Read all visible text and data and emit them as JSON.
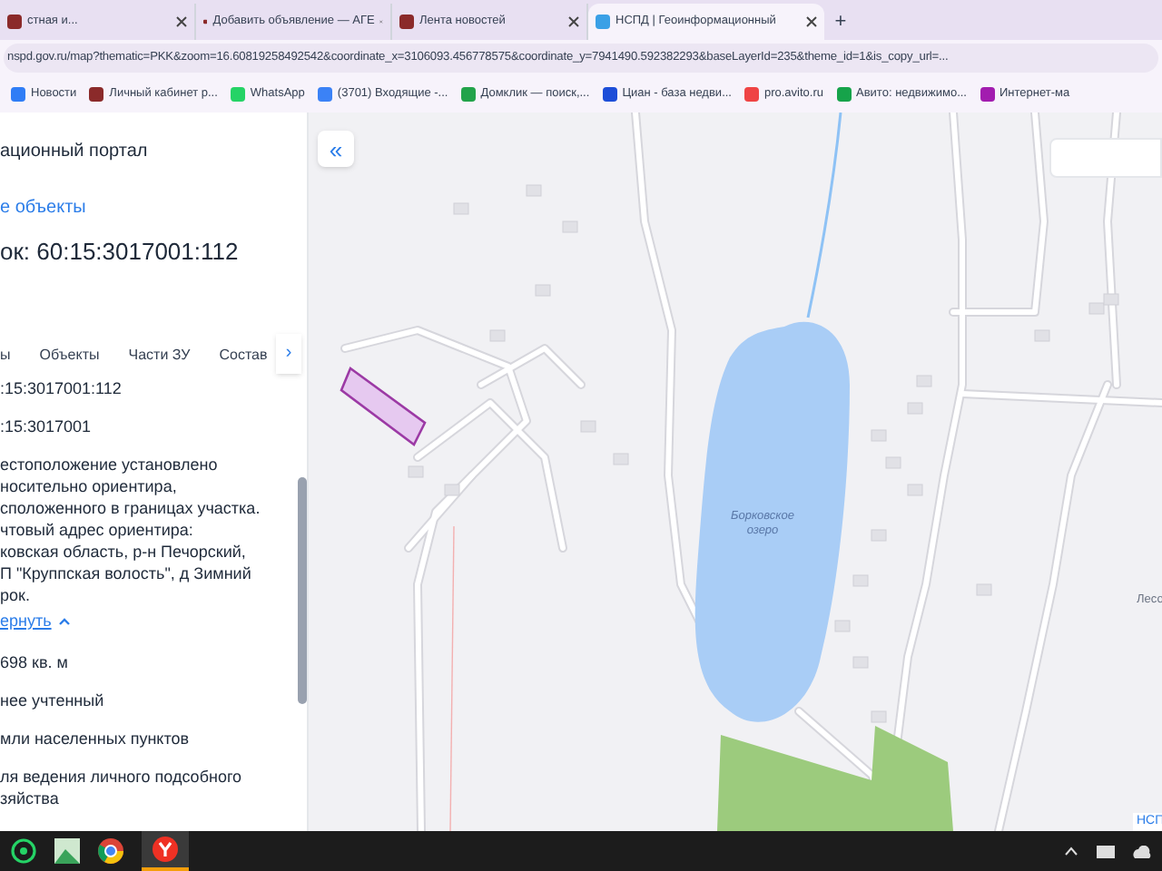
{
  "browser": {
    "tabs": [
      {
        "title": "стная и...",
        "selected": false
      },
      {
        "title": "Добавить объявление — АГЕ",
        "selected": false
      },
      {
        "title": "Лента новостей",
        "selected": false
      },
      {
        "title": "НСПД | Геоинформационный",
        "selected": true
      }
    ],
    "new_tab": "+",
    "url": "nspd.gov.ru/map?thematic=PKK&zoom=16.60819258492542&coordinate_x=3106093.456778575&coordinate_y=7941490.592382293&baseLayerId=235&theme_id=1&is_copy_url=...",
    "bookmarks": [
      {
        "label": "Новости",
        "color": "#2f7df6"
      },
      {
        "label": "Личный кабинет р...",
        "color": "#8b2a2a"
      },
      {
        "label": "WhatsApp",
        "color": "#25d366"
      },
      {
        "label": "(3701) Входящие -...",
        "color": "#3b82f6"
      },
      {
        "label": "Домклик — поиск,...",
        "color": "#22a34a"
      },
      {
        "label": "Циан - база недви...",
        "color": "#1d4ed8"
      },
      {
        "label": "pro.avito.ru",
        "color": "#ef4444"
      },
      {
        "label": "Авито: недвижимо...",
        "color": "#16a34a"
      },
      {
        "label": "Интернет-ма",
        "color": "#a21caf"
      }
    ]
  },
  "panel": {
    "portal_title": "ационный портал",
    "back_link": "е объекты",
    "heading": "ок: 60:15:3017001:112",
    "tabs": [
      "ы",
      "Объекты",
      "Части ЗУ",
      "Состав"
    ],
    "tabs_next": "›",
    "fields": [
      {
        "lines": [
          ":15:3017001:112"
        ]
      },
      {
        "lines": [
          ":15:3017001"
        ]
      },
      {
        "lines": [
          "естоположение установлено",
          "носительно ориентира,",
          "сположенного в границах участка.",
          "чтовый адрес ориентира:",
          "ковская область, р-н Печорский,",
          "П \"Круппская волость\", д Зимний",
          "рок."
        ],
        "link": "ернуть"
      },
      {
        "lines": [
          "698 кв. м"
        ]
      },
      {
        "lines": [
          "нее учтенный"
        ]
      },
      {
        "lines": [
          "мли населенных пунктов"
        ]
      },
      {
        "lines": [
          "ля ведения личного подсобного",
          "зяйства"
        ]
      }
    ]
  },
  "map": {
    "collapse_button": "«",
    "lake_label": [
      "Борковское",
      "озеро"
    ],
    "street_label": "Лесо",
    "corner_label": "НСП"
  }
}
